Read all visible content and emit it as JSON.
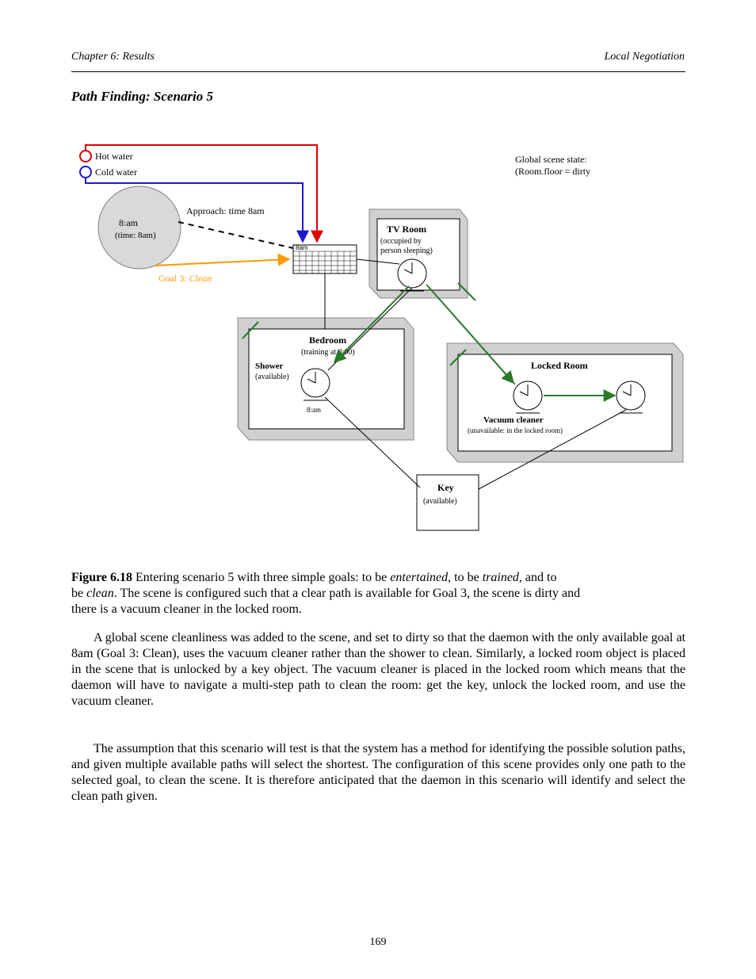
{
  "header": {
    "left": "Chapter 6: Results",
    "right": "Local Negotiation"
  },
  "heading": "Path Finding: Scenario 5",
  "diagram": {
    "labels": {
      "hot": "Hot water",
      "cold": "Cold water",
      "clock_small": "8:am",
      "clock_behind": "(time: 8am)",
      "start_time": "8am",
      "approach_dotted": "Approach: time 8am",
      "goal_orange_1": "Goal 3:  ",
      "goal_orange_2": "Clean",
      "global_state_1": " Global scene state:",
      "global_state_2": "(Room.floor = dirty",
      "box_occupied_1": "  (occupied by ",
      "box_occupied_2": "person sleeping)",
      "box_training": "(training at 8:00)",
      "bedroom_clock": "8:am",
      "shower_title": "Shower",
      "shower_state": "(available)",
      "vacuum_title": "Vacuum cleaner",
      "vacuum_state": "(unavailable: in the locked room)",
      "tv_room": "TV Room",
      "bedroom": "Bedroom",
      "locked_room": "Locked Room",
      "key_title": "Key",
      "key_state": "(available)"
    }
  },
  "captions": {
    "c1a": "Figure 6.18",
    "c1b": " Entering scenario 5 with three simple goals: to be ",
    "c1i": "entertained",
    "c1c": ", to be ",
    "c1i2": "trained",
    "c1d": ", and to",
    "c2a": "be ",
    "c2i": "clean",
    "c2b": ". The scene is configured such that a clear path is available for Goal 3, the scene is dirty and",
    "c3": "there is a vacuum cleaner in the locked room."
  },
  "para1": {
    "text": "A global scene cleanliness was added to the scene, and set to dirty so that the daemon with the only available goal at 8am (Goal 3: Clean), uses the vacuum cleaner rather than the shower to clean. Similarly, a locked room object is placed in the scene that is unlocked by a key object. The vacuum cleaner is placed in the locked room which means that the daemon will have to navigate a multi-step path to clean the room: get the key, unlock the locked room, and use the vacuum cleaner."
  },
  "para2": {
    "text": "The assumption that this scenario will test is that the system has a method for identifying the possible solution paths, and given multiple available paths will select the shortest. The configuration of this scene provides only one path to the selected goal, to clean the scene. It is therefore anticipated that the daemon in this scenario will identify and select the clean path given."
  },
  "footer_page": "169"
}
